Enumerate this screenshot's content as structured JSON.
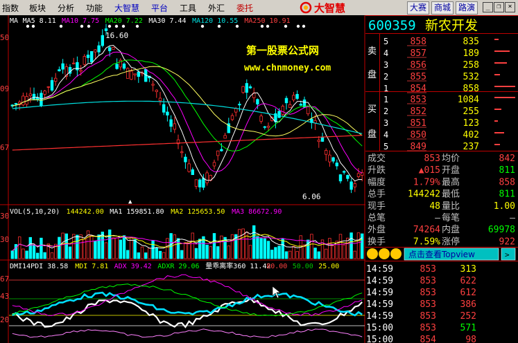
{
  "menu": {
    "items": [
      {
        "label": "指数",
        "color": "#000000"
      },
      {
        "label": "板块",
        "color": "#000000"
      },
      {
        "label": "分析",
        "color": "#000000"
      },
      {
        "label": "功能",
        "color": "#000000"
      },
      {
        "label": "大智慧",
        "color": "#0000c0"
      },
      {
        "label": "平台",
        "color": "#0000c0"
      },
      {
        "label": "工具",
        "color": "#000000"
      },
      {
        "label": "外汇",
        "color": "#000000"
      },
      {
        "label": "委托",
        "color": "#c00000"
      }
    ],
    "logo_text": "大智慧",
    "right_buttons": [
      "大赛",
      "商城",
      "路演"
    ],
    "window_buttons": {
      "minimize": "_",
      "restore": "❐",
      "close": "×"
    }
  },
  "watermark": {
    "line1": "第一股票公式网",
    "line2": "www.chnmoney.com"
  },
  "kline": {
    "ma_legend": [
      {
        "label": "MA",
        "color": "#ffffff"
      },
      {
        "label": "MA5 8.11",
        "color": "#ffffff"
      },
      {
        "label": "MA10 7.75",
        "color": "#ff00ff"
      },
      {
        "label": "MA20 7.22",
        "color": "#00ff00"
      },
      {
        "label": "MA30 7.44",
        "color": "#ffffff"
      },
      {
        "label": "MA120 10.55",
        "color": "#00e0e0"
      },
      {
        "label": "MA250 10.91",
        "color": "#ff4040"
      }
    ],
    "axis_labels": [
      "50",
      "09",
      "67"
    ],
    "high_label": "16.60",
    "low_label": "6.06"
  },
  "vol": {
    "legend": [
      {
        "label": "VOL(5,10,20)",
        "color": "#ffffff"
      },
      {
        "label": "144242.00",
        "color": "#ffff00"
      },
      {
        "label": "MA1 159851.80",
        "color": "#ffffff"
      },
      {
        "label": "MA2 125653.50",
        "color": "#ffff00"
      },
      {
        "label": "MA3 86672.90",
        "color": "#ff00ff"
      }
    ],
    "axis_labels": [
      "30",
      "30"
    ]
  },
  "dmi": {
    "legend": [
      {
        "label": "DMI14PDI 38.58",
        "color": "#ffffff"
      },
      {
        "label": "MDI 7.81",
        "color": "#ffff00"
      },
      {
        "label": "ADX 39.42",
        "color": "#ff00ff"
      },
      {
        "label": "ADXR 29.06",
        "color": "#00ff00"
      },
      {
        "label": "量乖离率360 11.42",
        "color": "#ffffff"
      },
      {
        "label": "80.00",
        "color": "#ff4040"
      },
      {
        "label": "50.00",
        "color": "#00c000"
      },
      {
        "label": "25.00",
        "color": "#ffff00"
      }
    ],
    "axis_labels": [
      "67",
      "43",
      "20"
    ]
  },
  "quote": {
    "code": "600359",
    "name": "新农开发",
    "sell_label": [
      "卖",
      "盘"
    ],
    "buy_label": [
      "买",
      "盘"
    ],
    "sell": [
      {
        "level": "5",
        "price": "858",
        "vol": "835"
      },
      {
        "level": "4",
        "price": "857",
        "vol": "189"
      },
      {
        "level": "3",
        "price": "856",
        "vol": "258"
      },
      {
        "level": "2",
        "price": "855",
        "vol": "532"
      },
      {
        "level": "1",
        "price": "854",
        "vol": "858"
      }
    ],
    "buy": [
      {
        "level": "1",
        "price": "853",
        "vol": "1084"
      },
      {
        "level": "2",
        "price": "852",
        "vol": "255"
      },
      {
        "level": "3",
        "price": "851",
        "vol": "123"
      },
      {
        "level": "4",
        "price": "850",
        "vol": "402"
      },
      {
        "level": "5",
        "price": "849",
        "vol": "237"
      }
    ],
    "stats": [
      {
        "l1": "成交",
        "v1": "853",
        "c1": "#ff4040",
        "l2": "均价",
        "v2": "842",
        "c2": "#ff4040"
      },
      {
        "l1": "升跌",
        "v1": "▲015",
        "c1": "#ff4040",
        "l2": "开盘",
        "v2": "811",
        "c2": "#00ff00"
      },
      {
        "l1": "幅度",
        "v1": "1.79%",
        "c1": "#ff4040",
        "l2": "最高",
        "v2": "858",
        "c2": "#ff4040"
      },
      {
        "l1": "总手",
        "v1": "144242",
        "c1": "#ffff00",
        "l2": "最低",
        "v2": "811",
        "c2": "#00ff00"
      },
      {
        "l1": "现手",
        "v1": "48",
        "c1": "#ffff00",
        "l2": "量比",
        "v2": "1.00",
        "c2": "#ffff00"
      },
      {
        "l1": "总笔",
        "v1": "—",
        "c1": "#c0c0c0",
        "l2": "每笔",
        "v2": "—",
        "c2": "#c0c0c0"
      },
      {
        "l1": "外盘",
        "v1": "74264",
        "c1": "#ff4040",
        "l2": "内盘",
        "v2": "69978",
        "c2": "#00ff00"
      },
      {
        "l1": "换手",
        "v1": "7.59%",
        "c1": "#ffff00",
        "l2": "涨停",
        "v2": "922",
        "c2": "#ff4040"
      }
    ],
    "topview_label": "点击查看Topview",
    "ticks": [
      {
        "time": "14:59",
        "price": "853",
        "vol": "313",
        "vc": "#ffff00"
      },
      {
        "time": "14:59",
        "price": "853",
        "vol": "622",
        "vc": "#ff4040"
      },
      {
        "time": "14:59",
        "price": "853",
        "vol": "612",
        "vc": "#ff4040"
      },
      {
        "time": "14:59",
        "price": "853",
        "vol": "386",
        "vc": "#ff4040"
      },
      {
        "time": "14:59",
        "price": "853",
        "vol": "252",
        "vc": "#ff4040"
      },
      {
        "time": "15:00",
        "price": "853",
        "vol": "571",
        "vc": "#00ff00"
      },
      {
        "time": "15:00",
        "price": "854",
        "vol": "98",
        "vc": "#ff4040"
      }
    ]
  }
}
